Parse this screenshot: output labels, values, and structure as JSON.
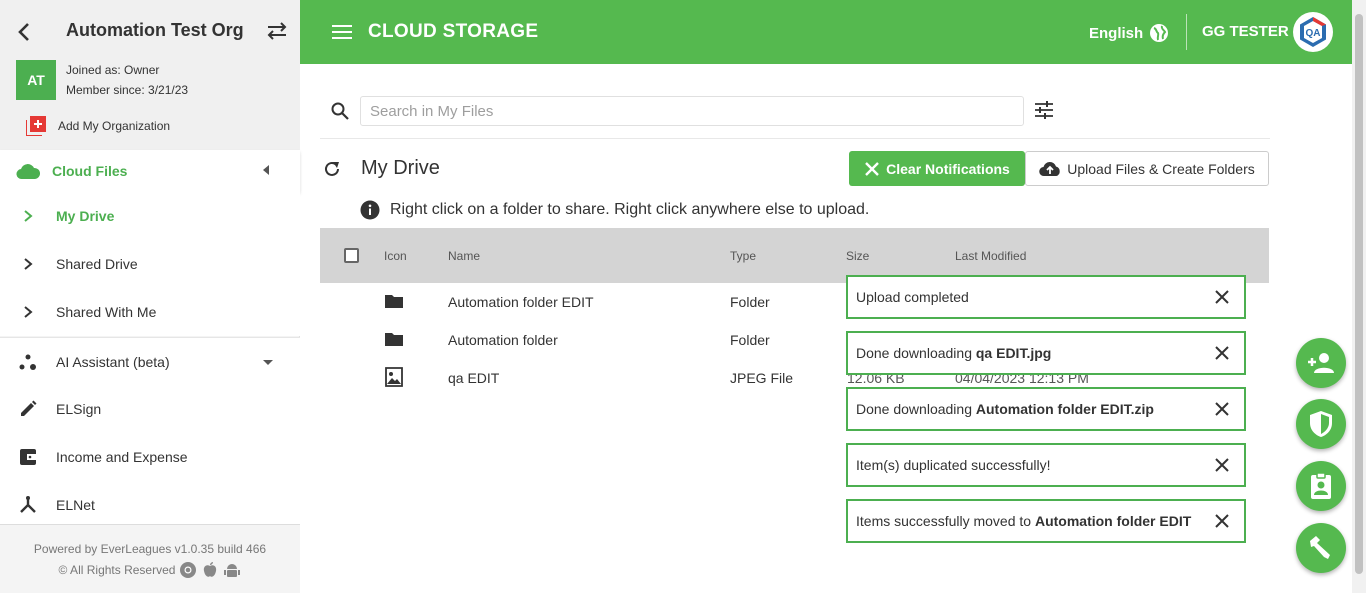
{
  "sidebar": {
    "org_title": "Automation Test Org",
    "avatar_initials": "AT",
    "joined_as": "Joined as: Owner",
    "member_since": "Member since: 3/21/23",
    "add_org": "Add My Organization",
    "cloud_files": "Cloud Files",
    "sub_items": [
      "My Drive",
      "Shared Drive",
      "Shared With Me"
    ],
    "items": [
      "AI Assistant (beta)",
      "ELSign",
      "Income and Expense",
      "ELNet"
    ],
    "footer_line1": "Powered by EverLeagues v1.0.35 build 466",
    "footer_line2": "© All Rights Reserved",
    "accent": "#4caf50"
  },
  "header": {
    "title": "CLOUD STORAGE",
    "language": "English",
    "username": "GG TESTER",
    "avatar_text": "QA",
    "bg": "#55b94f"
  },
  "search": {
    "placeholder": "Search in My Files"
  },
  "main": {
    "title": "My Drive",
    "clear_notifications": "Clear Notifications",
    "upload": "Upload Files & Create Folders",
    "info": "Right click on a folder to share. Right click anywhere else to upload."
  },
  "table": {
    "headers": [
      "Icon",
      "Name",
      "Type",
      "Size",
      "Last Modified"
    ],
    "rows": [
      {
        "icon": "folder-icon",
        "name": "Automation folder EDIT",
        "type": "Folder",
        "size": "",
        "modified": ""
      },
      {
        "icon": "folder-icon",
        "name": "Automation folder",
        "type": "Folder",
        "size": "",
        "modified": ""
      },
      {
        "icon": "image-file-icon",
        "name": "qa EDIT",
        "type": "JPEG File",
        "size": "12.06 KB",
        "modified": "04/04/2023 12:13 PM"
      }
    ]
  },
  "toasts": [
    {
      "prefix": "Upload completed",
      "bold": ""
    },
    {
      "prefix": "Done downloading ",
      "bold": "qa EDIT.jpg"
    },
    {
      "prefix": "Done downloading ",
      "bold": "Automation folder EDIT.zip"
    },
    {
      "prefix": "Item(s) duplicated successfully!",
      "bold": ""
    },
    {
      "prefix": "Items successfully moved to ",
      "bold": "Automation folder EDIT"
    }
  ],
  "fabs": [
    "add-user-icon",
    "shield-icon",
    "badge-icon",
    "tool-icon"
  ]
}
